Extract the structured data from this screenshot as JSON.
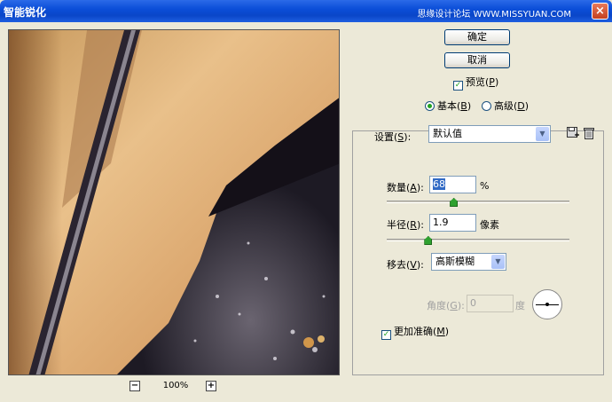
{
  "window": {
    "title": "智能锐化",
    "watermark": "思缘设计论坛 WWW.MISSYUAN.COM",
    "close_glyph": "×"
  },
  "zoom": {
    "level": "100%",
    "minus_glyph": "−",
    "plus_glyph": "+"
  },
  "buttons": {
    "ok": "确定",
    "cancel": "取消"
  },
  "preview_check": {
    "label": "预览(",
    "key": "P",
    "suffix": ")",
    "checked": true
  },
  "mode": {
    "basic": {
      "label": "基本(",
      "key": "B",
      "suffix": ")",
      "selected": true
    },
    "advanced": {
      "label": "高级(",
      "key": "D",
      "suffix": ")",
      "selected": false
    }
  },
  "settings": {
    "label": "设置(",
    "key": "S",
    "suffix": "):",
    "value": "默认值"
  },
  "amount": {
    "label": "数量(",
    "key": "A",
    "suffix": "):",
    "value": "68",
    "unit": "%",
    "slider": 0.37
  },
  "radius": {
    "label": "半径(",
    "key": "R",
    "suffix": "):",
    "value": "1.9",
    "unit": "像素",
    "slider": 0.23
  },
  "remove": {
    "label": "移去(",
    "key": "V",
    "suffix": "):",
    "value": "高斯模糊"
  },
  "angle": {
    "label": "角度(",
    "key": "G",
    "suffix": "):",
    "value": "0",
    "unit": "度"
  },
  "more_accurate": {
    "label": "更加准确(",
    "key": "M",
    "suffix": ")",
    "checked": true
  },
  "icons": {
    "save": "disk-icon",
    "delete": "trash-icon",
    "dropdown": "chevron-down-icon",
    "check": "✓",
    "arrow": "▼"
  }
}
